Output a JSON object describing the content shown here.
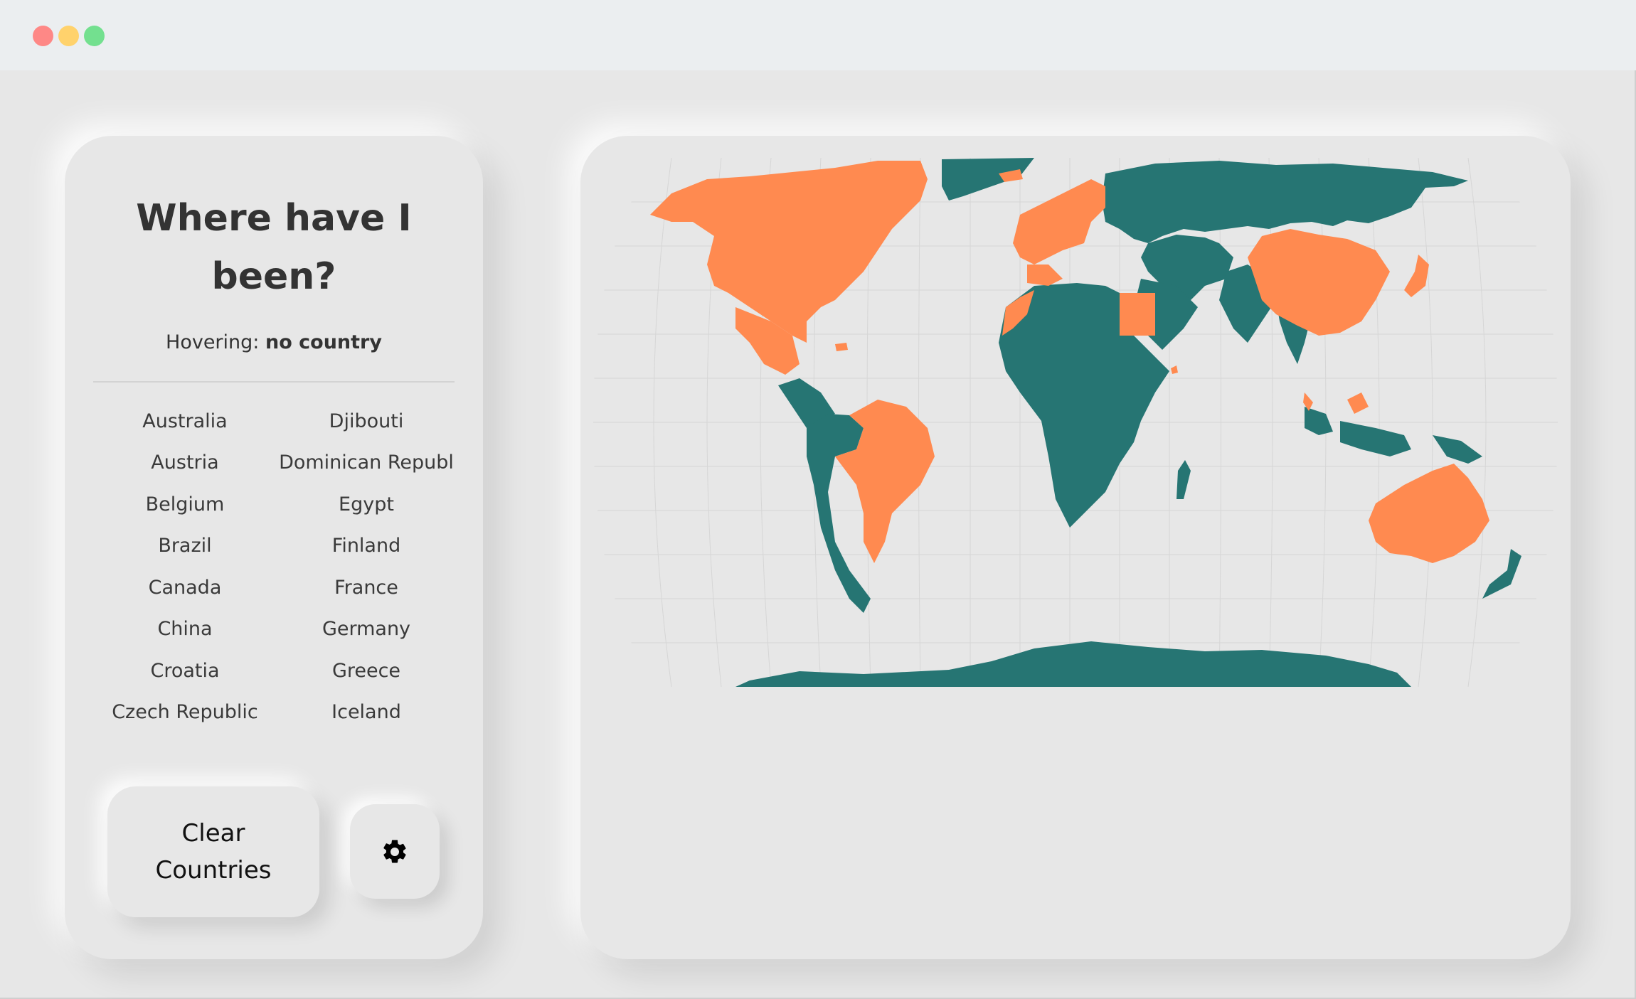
{
  "app": {
    "title_line1": "Where have I",
    "title_line2": "been?"
  },
  "hover": {
    "label": "Hovering:",
    "value": "no country"
  },
  "countries": [
    "Australia",
    "Djibouti",
    "Austria",
    "Dominican Republ",
    "Belgium",
    "Egypt",
    "Brazil",
    "Finland",
    "Canada",
    "France",
    "China",
    "Germany",
    "Croatia",
    "Greece",
    "Czech Republic",
    "Iceland"
  ],
  "buttons": {
    "clear_line1": "Clear",
    "clear_line2": "Countries",
    "settings_icon": "gear-icon"
  },
  "colors": {
    "visited": "#ff8a50",
    "unvisited": "#267573",
    "grid": "#d9d9d9"
  },
  "icons": {
    "map": "world-map"
  }
}
